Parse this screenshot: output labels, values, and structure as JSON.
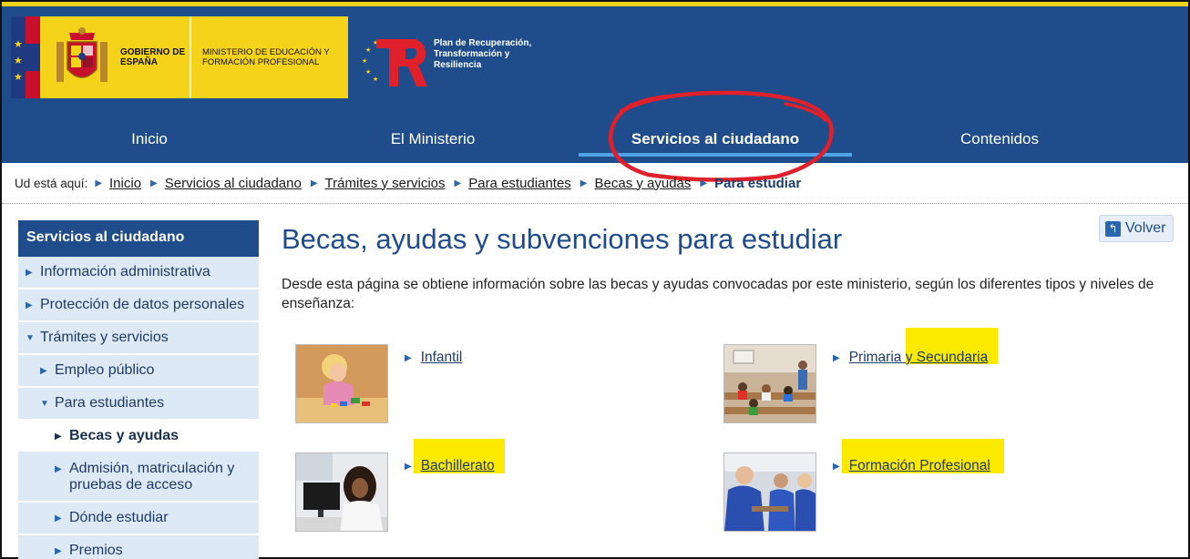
{
  "header": {
    "gobierno": "GOBIERNO DE ESPAÑA",
    "ministerio": "MINISTERIO DE EDUCACIÓN Y FORMACIÓN PROFESIONAL",
    "plan": "Plan de Recuperación, Transformación y Resiliencia",
    "colors": {
      "navy": "#1f4c8a",
      "yellow": "#f6d31b",
      "active_underline": "#4ea3e6",
      "annotation_red": "#e0202a"
    }
  },
  "nav": {
    "items": [
      {
        "label": "Inicio"
      },
      {
        "label": "El Ministerio"
      },
      {
        "label": "Servicios al ciudadano",
        "active": true
      },
      {
        "label": "Contenidos"
      }
    ]
  },
  "breadcrumb": {
    "label": "Ud está aquí:",
    "items": [
      "Inicio",
      "Servicios al ciudadano",
      "Trámites y servicios",
      "Para estudiantes",
      "Becas y ayudas"
    ],
    "current": "Para estudiar"
  },
  "sidebar": {
    "title": "Servicios al ciudadano",
    "items": [
      {
        "label": "Información administrativa"
      },
      {
        "label": "Protección de datos personales"
      },
      {
        "label": "Trámites y servicios"
      },
      {
        "label": "Empleo público"
      },
      {
        "label": "Para estudiantes"
      },
      {
        "label": "Becas y ayudas"
      },
      {
        "label": "Admisión, matriculación y pruebas de acceso"
      },
      {
        "label": "Dónde estudiar"
      },
      {
        "label": "Premios"
      }
    ]
  },
  "main": {
    "back_label": "Volver",
    "title": "Becas, ayudas y subvenciones para estudiar",
    "intro": "Desde esta página se obtiene información sobre las becas y ayudas convocadas por este ministerio, según los diferentes tipos y niveles de enseñanza:",
    "cards": [
      {
        "label": "Infantil"
      },
      {
        "label": "Primaria y Secundaria"
      },
      {
        "label": "Bachillerato"
      },
      {
        "label": "Formación Profesional"
      }
    ]
  }
}
